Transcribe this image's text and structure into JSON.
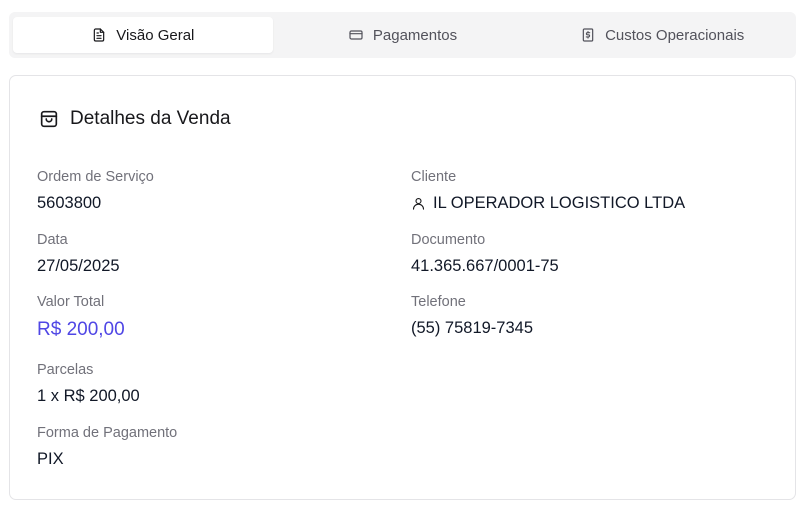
{
  "tabs": [
    {
      "label": "Visão Geral",
      "icon": "file-text-icon",
      "active": true
    },
    {
      "label": "Pagamentos",
      "icon": "credit-card-icon",
      "active": false
    },
    {
      "label": "Custos Operacionais",
      "icon": "receipt-dollar-icon",
      "active": false
    }
  ],
  "card": {
    "title": "Detalhes da Venda",
    "title_icon": "shopping-bag-icon",
    "left": {
      "ordem": {
        "label": "Ordem de Serviço",
        "value": "5603800"
      },
      "data": {
        "label": "Data",
        "value": "27/05/2025"
      },
      "valor_total": {
        "label": "Valor Total",
        "value": "R$ 200,00"
      },
      "parcelas": {
        "label": "Parcelas",
        "value": "1 x R$ 200,00"
      },
      "forma_pagamento": {
        "label": "Forma de Pagamento",
        "value": "PIX"
      }
    },
    "right": {
      "cliente": {
        "label": "Cliente",
        "value": "IL OPERADOR LOGISTICO LTDA",
        "icon": "user-icon"
      },
      "documento": {
        "label": "Documento",
        "value": "41.365.667/0001-75"
      },
      "telefone": {
        "label": "Telefone",
        "value": "(55) 75819-7345"
      }
    }
  },
  "colors": {
    "accent": "#4f46e5",
    "tab_bg": "#f4f4f5",
    "muted_text": "#71717a"
  }
}
